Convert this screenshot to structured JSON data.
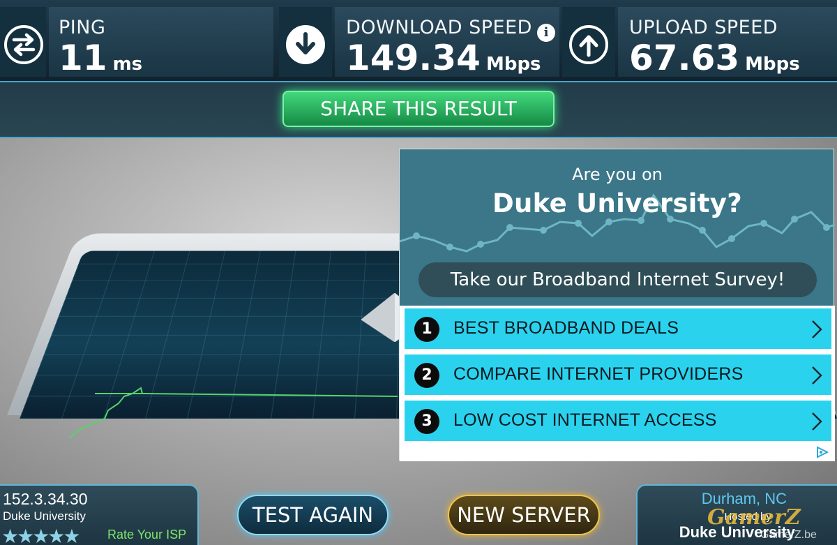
{
  "stats": {
    "ping": {
      "label": "PING",
      "value": "11",
      "unit": "ms",
      "icon": "ping-arrows-icon"
    },
    "download": {
      "label": "DOWNLOAD SPEED",
      "value": "149.34",
      "unit": "Mbps",
      "icon": "download-arrow-icon",
      "info": "i"
    },
    "upload": {
      "label": "UPLOAD SPEED",
      "value": "67.63",
      "unit": "Mbps",
      "icon": "upload-arrow-icon"
    }
  },
  "share": {
    "label": "SHARE THIS RESULT"
  },
  "ad": {
    "kicker": "Are you on",
    "headline": "Duke University?",
    "survey_button": "Take our Broadband Internet Survey!",
    "items": [
      {
        "num": "1",
        "label": "BEST BROADBAND DEALS"
      },
      {
        "num": "2",
        "label": "COMPARE INTERNET PROVIDERS"
      },
      {
        "num": "3",
        "label": "LOW COST INTERNET ACCESS"
      }
    ]
  },
  "isp": {
    "ip": "152.3.34.30",
    "name": "Duke University",
    "stars": "★★★★★",
    "rate_link": "Rate Your ISP"
  },
  "actions": {
    "test_again": "TEST AGAIN",
    "new_server": "NEW SERVER"
  },
  "server": {
    "city": "Durham, NC",
    "hosted_label": "Hosted by",
    "host": "Duke University"
  },
  "watermark": {
    "brand": "GamerZ",
    "url": "GamerZ.be"
  },
  "colors": {
    "share_green": "#2fe07a",
    "ad_cyan": "#2bd2ee",
    "new_server_gold": "#f0c44c",
    "test_again_blue": "#8fd8f4"
  }
}
